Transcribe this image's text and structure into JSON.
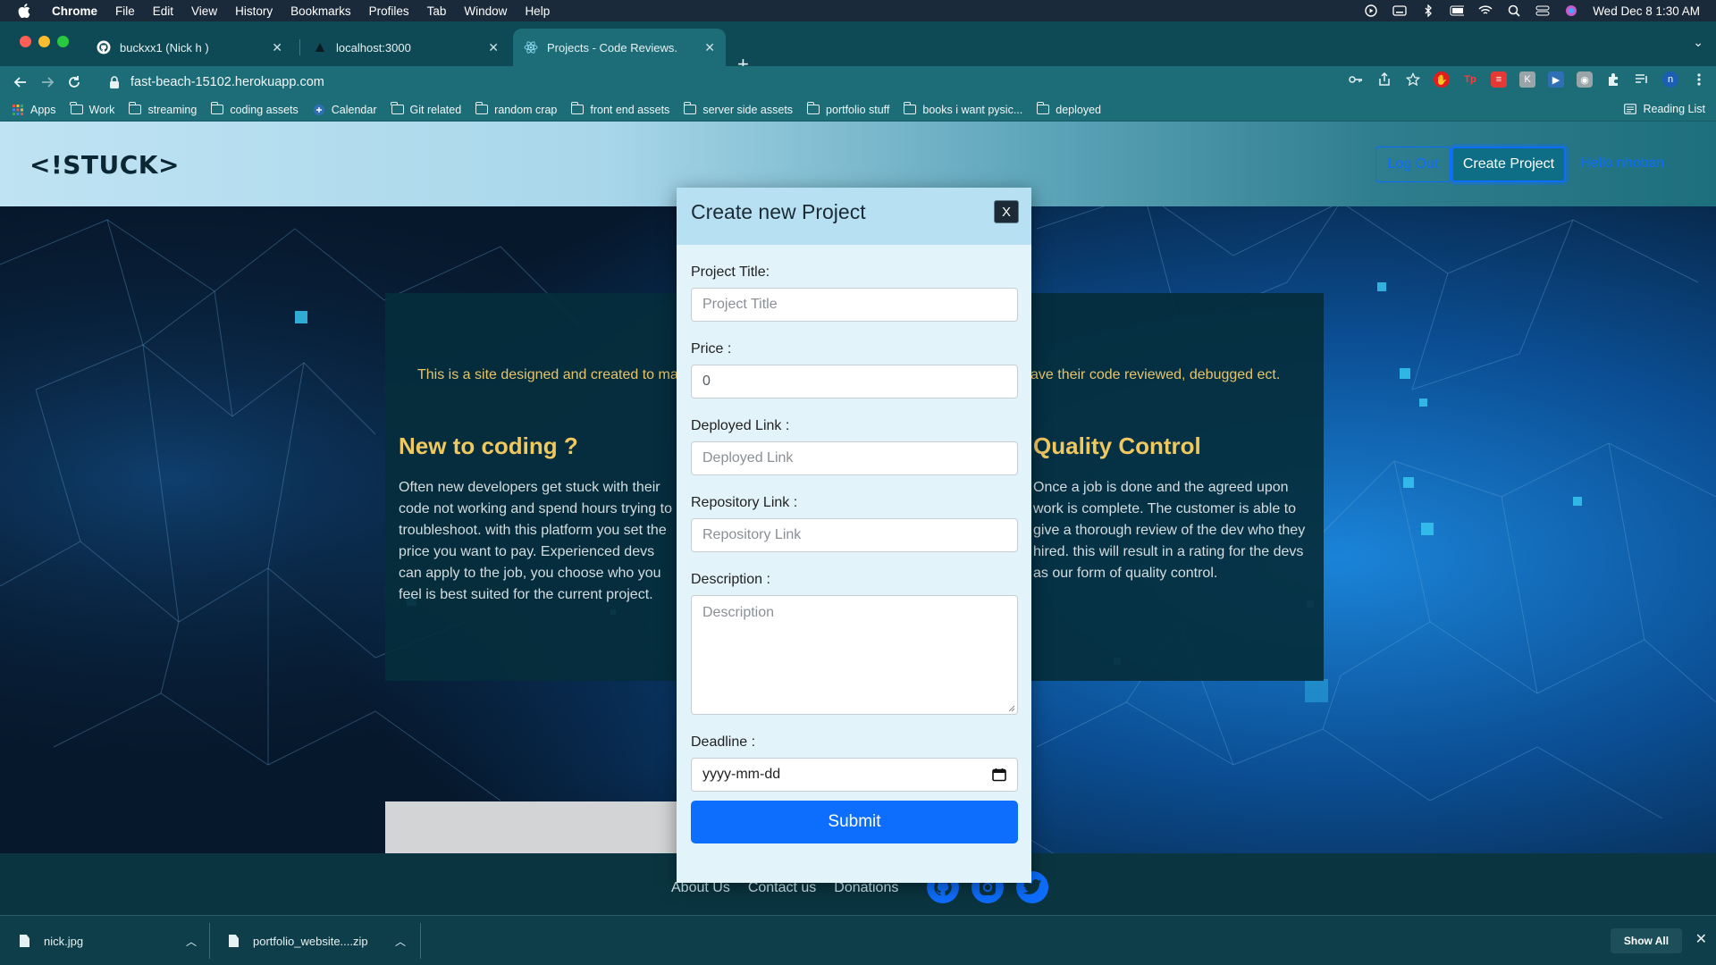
{
  "menubar": {
    "app": "Chrome",
    "items": [
      "File",
      "Edit",
      "View",
      "History",
      "Bookmarks",
      "Profiles",
      "Tab",
      "Window",
      "Help"
    ],
    "clock": "Wed Dec 8  1:30 AM"
  },
  "tabs": [
    {
      "title": "buckxx1 (Nick h )",
      "icon": "github-icon"
    },
    {
      "title": "localhost:3000",
      "icon": "app-icon"
    },
    {
      "title": "Projects - Code Reviews.",
      "icon": "react-icon",
      "active": true
    }
  ],
  "address": {
    "url": "fast-beach-15102.herokuapp.com"
  },
  "bookmarks": {
    "apps": "Apps",
    "items": [
      "Work",
      "streaming",
      "coding assets",
      "Calendar",
      "Git related",
      "random crap",
      "front end assets",
      "server side assets",
      "portfolio stuff",
      "books i want pysic...",
      "deployed"
    ],
    "reading_list": "Reading List"
  },
  "site": {
    "logo": "<!STUCK>",
    "logout": "Log Out",
    "create_project": "Create Project",
    "hello": "Hello nhoban",
    "intro_left": "This is a site designed and created to ma",
    "intro_right": "ave their code reviewed, debugged ect.",
    "col1_title": "New to coding ?",
    "col1_text": "Often new developers get stuck with their code not working and spend hours trying to troubleshoot. with this platform you set the price you want to pay. Experienced devs can apply to the job, you choose who you feel is best suited for the current project.",
    "col2_title": "Quality Control",
    "col2_text": "Once a job is done and the agreed upon work is complete. The customer is able to give a thorough review of the dev who they hired. this will result in a rating for the devs as our form of quality control."
  },
  "footer": {
    "links": [
      "About Us",
      "Contact us",
      "Donations"
    ]
  },
  "modal": {
    "title": "Create new Project",
    "close": "X",
    "fields": {
      "title_label": "Project Title:",
      "title_placeholder": "Project Title",
      "price_label": "Price :",
      "price_value": "0",
      "deployed_label": "Deployed Link :",
      "deployed_placeholder": "Deployed Link",
      "repo_label": "Repository Link :",
      "repo_placeholder": "Repository Link",
      "desc_label": "Description :",
      "desc_placeholder": "Description",
      "deadline_label": "Deadline :",
      "deadline_placeholder": "yyyy-mm-dd"
    },
    "submit": "Submit"
  },
  "downloads": {
    "items": [
      "nick.jpg",
      "portfolio_website....zip"
    ],
    "show_all": "Show All"
  },
  "colors": {
    "primary": "#0d6efd",
    "accent_gold": "#f0c860",
    "header_light": "#bfe3f3",
    "chrome_teal": "#1d6d78"
  }
}
